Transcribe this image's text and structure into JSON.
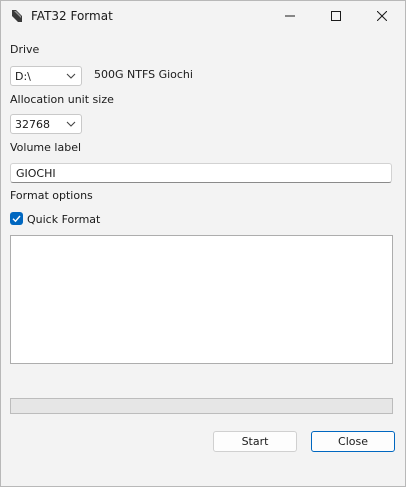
{
  "window": {
    "title": "FAT32 Format",
    "app_icon": "usb-drive-icon",
    "controls": [
      "minimize-icon",
      "maximize-icon",
      "close-icon"
    ]
  },
  "drive": {
    "label": "Drive",
    "selected": "D:\\",
    "info": "500G NTFS Giochi"
  },
  "allocation": {
    "label": "Allocation unit size",
    "selected": "32768"
  },
  "volume": {
    "label": "Volume label",
    "value": "GIOCHI"
  },
  "options": {
    "label": "Format options",
    "quick_format_label": "Quick Format",
    "quick_format_checked": true
  },
  "log": {
    "text": ""
  },
  "progress": {
    "value": 0
  },
  "buttons": {
    "start": "Start",
    "close": "Close"
  },
  "colors": {
    "accent": "#0067c0",
    "progress_fill": "#06b025"
  }
}
